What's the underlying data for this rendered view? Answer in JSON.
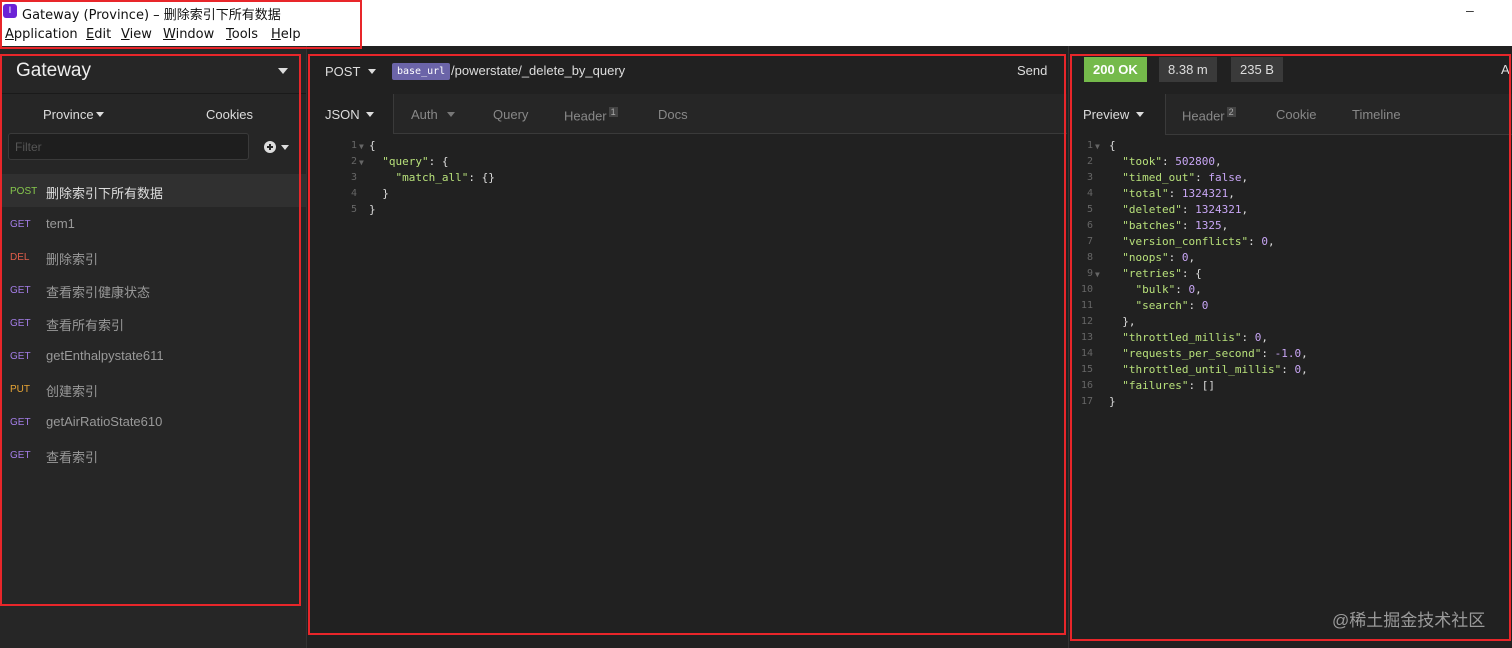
{
  "window": {
    "icon_label": "I",
    "title": "Gateway (Province) – 删除索引下所有数据",
    "minimize_symbol": "–"
  },
  "menu": [
    {
      "underline": "A",
      "rest": "pplication"
    },
    {
      "underline": "E",
      "rest": "dit"
    },
    {
      "underline": "V",
      "rest": "iew"
    },
    {
      "underline": "W",
      "rest": "indow"
    },
    {
      "underline": "T",
      "rest": "ools"
    },
    {
      "underline": "H",
      "rest": "elp"
    }
  ],
  "sidebar": {
    "workspace": "Gateway",
    "environment": "Province",
    "cookies": "Cookies",
    "filter_placeholder": "Filter",
    "requests": [
      {
        "method": "POST",
        "name": "删除索引下所有数据",
        "color": "#86c64d",
        "active": true
      },
      {
        "method": "GET",
        "name": "tem1",
        "color": "#a37de6"
      },
      {
        "method": "DEL",
        "name": "删除索引",
        "color": "#e05d4a"
      },
      {
        "method": "GET",
        "name": "查看索引健康状态",
        "color": "#a37de6"
      },
      {
        "method": "GET",
        "name": "查看所有索引",
        "color": "#a37de6"
      },
      {
        "method": "GET",
        "name": "getEnthalpystate611",
        "color": "#a37de6"
      },
      {
        "method": "PUT",
        "name": "创建索引",
        "color": "#e8a535"
      },
      {
        "method": "GET",
        "name": "getAirRatioState610",
        "color": "#a37de6"
      },
      {
        "method": "GET",
        "name": "查看索引",
        "color": "#a37de6"
      }
    ]
  },
  "request": {
    "method": "POST",
    "base_url_tag": "base_url",
    "path": "/powerstate/_delete_by_query",
    "send_label": "Send",
    "tabs": {
      "body": "JSON",
      "auth": "Auth",
      "query": "Query",
      "header": "Header",
      "header_count": "1",
      "docs": "Docs"
    },
    "body_lines": [
      {
        "n": "1",
        "indent": "",
        "key": "",
        "text": "{",
        "fold": true
      },
      {
        "n": "2",
        "indent": "  ",
        "key": "\"query\"",
        "text": ": {",
        "fold": true
      },
      {
        "n": "3",
        "indent": "    ",
        "key": "\"match_all\"",
        "text": ": {}",
        "fold": false
      },
      {
        "n": "4",
        "indent": "  ",
        "key": "",
        "text": "}",
        "fold": false
      },
      {
        "n": "5",
        "indent": "",
        "key": "",
        "text": "}",
        "fold": false
      }
    ]
  },
  "response": {
    "status": "200 OK",
    "time": "8.38 m",
    "size": "235 B",
    "truncated_label": "A",
    "status_color": "#75ba4b",
    "tabs": {
      "preview": "Preview",
      "header": "Header",
      "header_count": "2",
      "cookie": "Cookie",
      "timeline": "Timeline"
    },
    "body_lines": [
      {
        "n": "1",
        "indent": "",
        "key": "",
        "val": "",
        "text": "{",
        "fold": true
      },
      {
        "n": "2",
        "indent": "  ",
        "key": "\"took\"",
        "val": "502800",
        "text": ",",
        "fold": false
      },
      {
        "n": "3",
        "indent": "  ",
        "key": "\"timed_out\"",
        "val": "false",
        "text": ",",
        "fold": false
      },
      {
        "n": "4",
        "indent": "  ",
        "key": "\"total\"",
        "val": "1324321",
        "text": ",",
        "fold": false
      },
      {
        "n": "5",
        "indent": "  ",
        "key": "\"deleted\"",
        "val": "1324321",
        "text": ",",
        "fold": false
      },
      {
        "n": "6",
        "indent": "  ",
        "key": "\"batches\"",
        "val": "1325",
        "text": ",",
        "fold": false
      },
      {
        "n": "7",
        "indent": "  ",
        "key": "\"version_conflicts\"",
        "val": "0",
        "text": ",",
        "fold": false
      },
      {
        "n": "8",
        "indent": "  ",
        "key": "\"noops\"",
        "val": "0",
        "text": ",",
        "fold": false
      },
      {
        "n": "9",
        "indent": "  ",
        "key": "\"retries\"",
        "val": "",
        "text": "{",
        "fold": true
      },
      {
        "n": "10",
        "indent": "    ",
        "key": "\"bulk\"",
        "val": "0",
        "text": ",",
        "fold": false
      },
      {
        "n": "11",
        "indent": "    ",
        "key": "\"search\"",
        "val": "0",
        "text": "",
        "fold": false
      },
      {
        "n": "12",
        "indent": "  ",
        "key": "",
        "val": "",
        "text": "},",
        "fold": false
      },
      {
        "n": "13",
        "indent": "  ",
        "key": "\"throttled_millis\"",
        "val": "0",
        "text": ",",
        "fold": false
      },
      {
        "n": "14",
        "indent": "  ",
        "key": "\"requests_per_second\"",
        "val": "-1.0",
        "text": ",",
        "fold": false
      },
      {
        "n": "15",
        "indent": "  ",
        "key": "\"throttled_until_millis\"",
        "val": "0",
        "text": ",",
        "fold": false
      },
      {
        "n": "16",
        "indent": "  ",
        "key": "\"failures\"",
        "val": "",
        "text": "[]",
        "fold": false
      },
      {
        "n": "17",
        "indent": "",
        "key": "",
        "val": "",
        "text": "}",
        "fold": false
      }
    ]
  },
  "watermark": "@稀土掘金技术社区",
  "highlight_color": "#e8262a"
}
